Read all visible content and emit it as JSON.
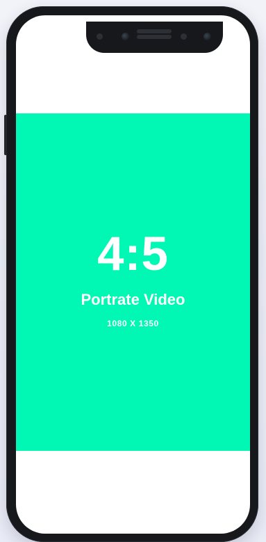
{
  "video": {
    "ratio": "4:5",
    "title": "Portrate Video",
    "dimensions": "1080 X 1350"
  },
  "colors": {
    "background": "#eef0f8",
    "phone_frame": "#16181b",
    "screen": "#ffffff",
    "video_fill": "#00f7b4",
    "text": "#ffffff"
  },
  "icons": {
    "frame": "phone-frame",
    "notch": "phone-notch",
    "camera": "front-camera-icon",
    "speaker": "speaker-grille-icon"
  }
}
